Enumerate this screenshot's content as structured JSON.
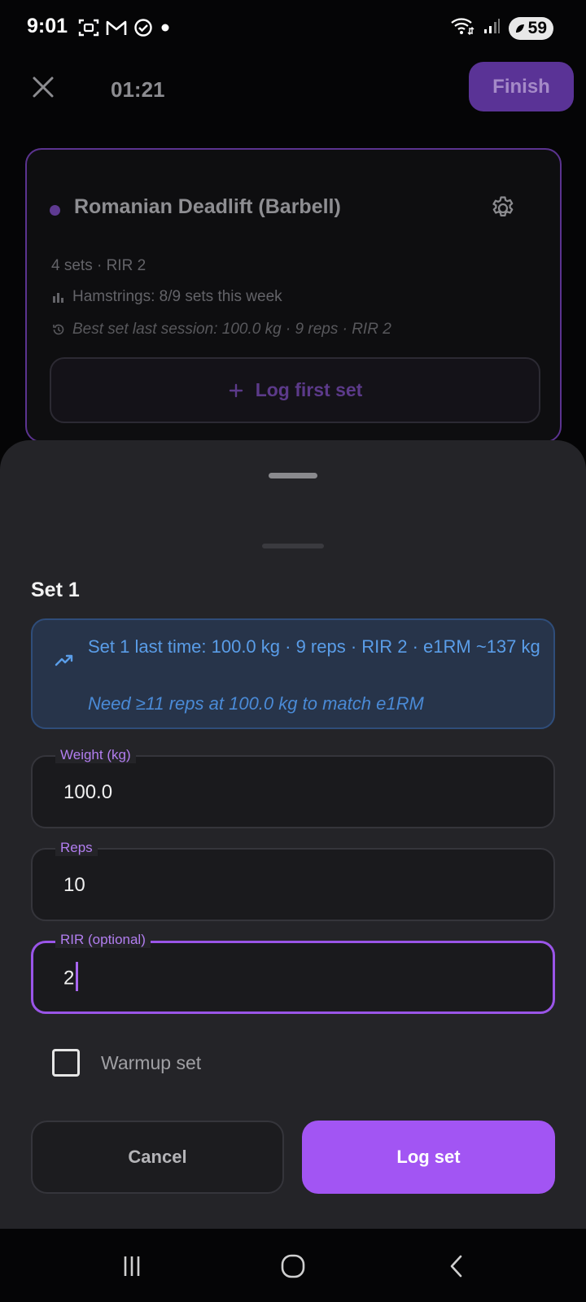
{
  "status_bar": {
    "time": "9:01",
    "battery": "59",
    "notification_icons": [
      "screenshot-icon",
      "gmail-icon",
      "check-circle-icon",
      "dot-icon"
    ],
    "system_icons": [
      "wifi-icon",
      "signal-icon",
      "battery-icon"
    ]
  },
  "top_bar": {
    "timer": "01:21",
    "finish_label": "Finish"
  },
  "exercise": {
    "title": "Romanian Deadlift (Barbell)",
    "sets_info": "4 sets · RIR 2",
    "muscle_volume": "Hamstrings: 8/9 sets this week",
    "best_set": "Best set last session: 100.0 kg · 9 reps · RIR 2",
    "log_first_label": "Log first set"
  },
  "sheet": {
    "title": "Set 1",
    "info": {
      "last_time": "Set 1 last time: 100.0 kg · 9 reps · RIR 2 · e1RM ~137 kg",
      "target": "Need ≥11 reps at 100.0 kg to match e1RM"
    },
    "fields": {
      "weight": {
        "label": "Weight (kg)",
        "value": "100.0"
      },
      "reps": {
        "label": "Reps",
        "value": "10"
      },
      "rir": {
        "label": "RIR (optional)",
        "value": "2"
      }
    },
    "warmup_label": "Warmup set",
    "warmup_checked": false,
    "cancel_label": "Cancel",
    "log_label": "Log set"
  },
  "colors": {
    "accent": "#a255f3",
    "info_text": "#5a9de8",
    "sheet_bg": "#242428"
  }
}
